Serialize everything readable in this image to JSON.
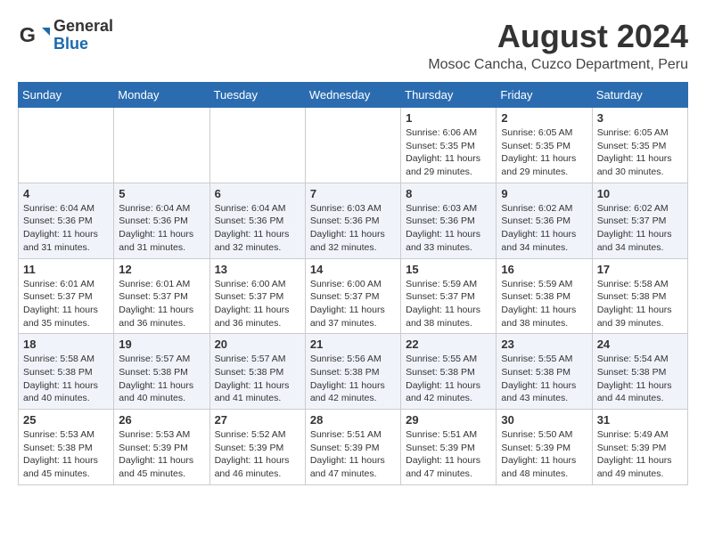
{
  "header": {
    "logo_general": "General",
    "logo_blue": "Blue",
    "month_year": "August 2024",
    "location": "Mosoc Cancha, Cuzco Department, Peru"
  },
  "weekdays": [
    "Sunday",
    "Monday",
    "Tuesday",
    "Wednesday",
    "Thursday",
    "Friday",
    "Saturday"
  ],
  "weeks": [
    [
      {
        "day": "",
        "info": ""
      },
      {
        "day": "",
        "info": ""
      },
      {
        "day": "",
        "info": ""
      },
      {
        "day": "",
        "info": ""
      },
      {
        "day": "1",
        "info": "Sunrise: 6:06 AM\nSunset: 5:35 PM\nDaylight: 11 hours and 29 minutes."
      },
      {
        "day": "2",
        "info": "Sunrise: 6:05 AM\nSunset: 5:35 PM\nDaylight: 11 hours and 29 minutes."
      },
      {
        "day": "3",
        "info": "Sunrise: 6:05 AM\nSunset: 5:35 PM\nDaylight: 11 hours and 30 minutes."
      }
    ],
    [
      {
        "day": "4",
        "info": "Sunrise: 6:04 AM\nSunset: 5:36 PM\nDaylight: 11 hours and 31 minutes."
      },
      {
        "day": "5",
        "info": "Sunrise: 6:04 AM\nSunset: 5:36 PM\nDaylight: 11 hours and 31 minutes."
      },
      {
        "day": "6",
        "info": "Sunrise: 6:04 AM\nSunset: 5:36 PM\nDaylight: 11 hours and 32 minutes."
      },
      {
        "day": "7",
        "info": "Sunrise: 6:03 AM\nSunset: 5:36 PM\nDaylight: 11 hours and 32 minutes."
      },
      {
        "day": "8",
        "info": "Sunrise: 6:03 AM\nSunset: 5:36 PM\nDaylight: 11 hours and 33 minutes."
      },
      {
        "day": "9",
        "info": "Sunrise: 6:02 AM\nSunset: 5:36 PM\nDaylight: 11 hours and 34 minutes."
      },
      {
        "day": "10",
        "info": "Sunrise: 6:02 AM\nSunset: 5:37 PM\nDaylight: 11 hours and 34 minutes."
      }
    ],
    [
      {
        "day": "11",
        "info": "Sunrise: 6:01 AM\nSunset: 5:37 PM\nDaylight: 11 hours and 35 minutes."
      },
      {
        "day": "12",
        "info": "Sunrise: 6:01 AM\nSunset: 5:37 PM\nDaylight: 11 hours and 36 minutes."
      },
      {
        "day": "13",
        "info": "Sunrise: 6:00 AM\nSunset: 5:37 PM\nDaylight: 11 hours and 36 minutes."
      },
      {
        "day": "14",
        "info": "Sunrise: 6:00 AM\nSunset: 5:37 PM\nDaylight: 11 hours and 37 minutes."
      },
      {
        "day": "15",
        "info": "Sunrise: 5:59 AM\nSunset: 5:37 PM\nDaylight: 11 hours and 38 minutes."
      },
      {
        "day": "16",
        "info": "Sunrise: 5:59 AM\nSunset: 5:38 PM\nDaylight: 11 hours and 38 minutes."
      },
      {
        "day": "17",
        "info": "Sunrise: 5:58 AM\nSunset: 5:38 PM\nDaylight: 11 hours and 39 minutes."
      }
    ],
    [
      {
        "day": "18",
        "info": "Sunrise: 5:58 AM\nSunset: 5:38 PM\nDaylight: 11 hours and 40 minutes."
      },
      {
        "day": "19",
        "info": "Sunrise: 5:57 AM\nSunset: 5:38 PM\nDaylight: 11 hours and 40 minutes."
      },
      {
        "day": "20",
        "info": "Sunrise: 5:57 AM\nSunset: 5:38 PM\nDaylight: 11 hours and 41 minutes."
      },
      {
        "day": "21",
        "info": "Sunrise: 5:56 AM\nSunset: 5:38 PM\nDaylight: 11 hours and 42 minutes."
      },
      {
        "day": "22",
        "info": "Sunrise: 5:55 AM\nSunset: 5:38 PM\nDaylight: 11 hours and 42 minutes."
      },
      {
        "day": "23",
        "info": "Sunrise: 5:55 AM\nSunset: 5:38 PM\nDaylight: 11 hours and 43 minutes."
      },
      {
        "day": "24",
        "info": "Sunrise: 5:54 AM\nSunset: 5:38 PM\nDaylight: 11 hours and 44 minutes."
      }
    ],
    [
      {
        "day": "25",
        "info": "Sunrise: 5:53 AM\nSunset: 5:38 PM\nDaylight: 11 hours and 45 minutes."
      },
      {
        "day": "26",
        "info": "Sunrise: 5:53 AM\nSunset: 5:39 PM\nDaylight: 11 hours and 45 minutes."
      },
      {
        "day": "27",
        "info": "Sunrise: 5:52 AM\nSunset: 5:39 PM\nDaylight: 11 hours and 46 minutes."
      },
      {
        "day": "28",
        "info": "Sunrise: 5:51 AM\nSunset: 5:39 PM\nDaylight: 11 hours and 47 minutes."
      },
      {
        "day": "29",
        "info": "Sunrise: 5:51 AM\nSunset: 5:39 PM\nDaylight: 11 hours and 47 minutes."
      },
      {
        "day": "30",
        "info": "Sunrise: 5:50 AM\nSunset: 5:39 PM\nDaylight: 11 hours and 48 minutes."
      },
      {
        "day": "31",
        "info": "Sunrise: 5:49 AM\nSunset: 5:39 PM\nDaylight: 11 hours and 49 minutes."
      }
    ]
  ]
}
